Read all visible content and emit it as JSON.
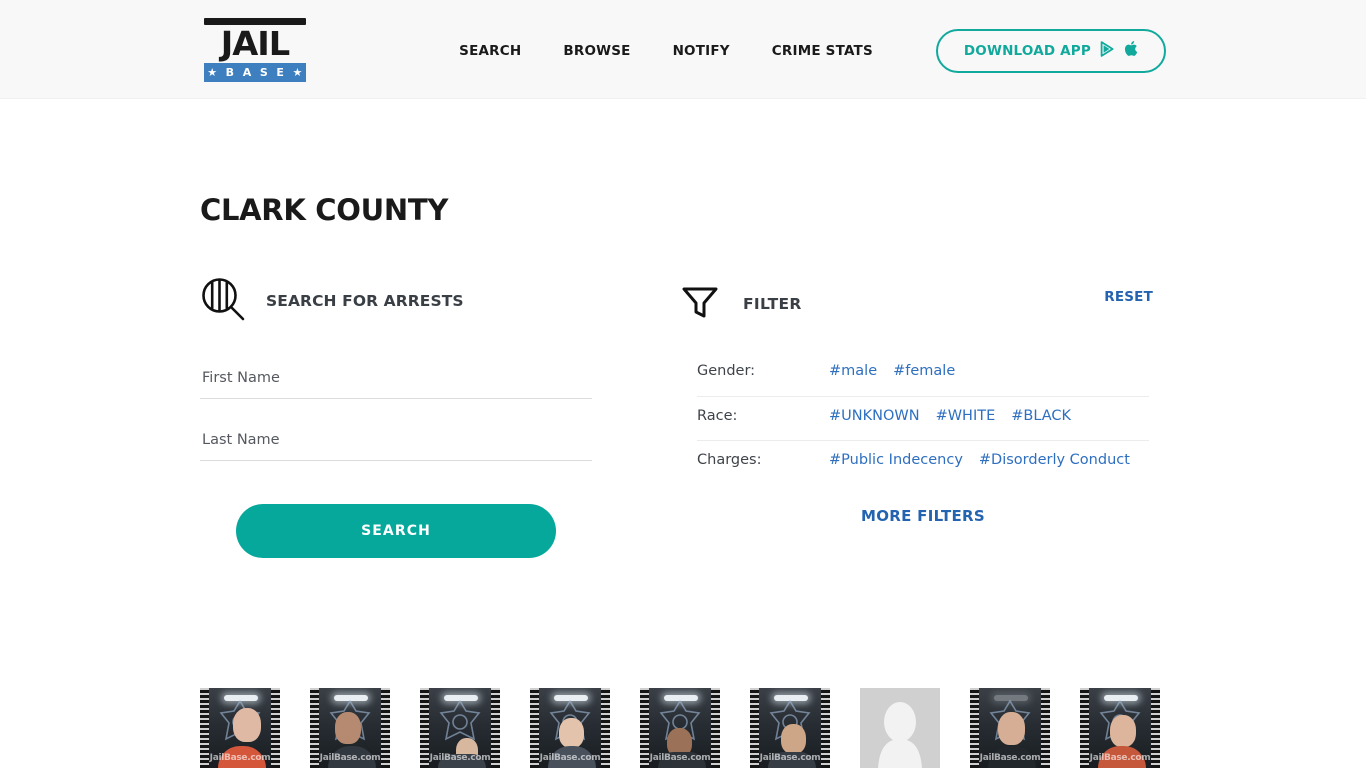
{
  "header": {
    "logo": {
      "name": "JailBase",
      "top_word": "JAIL",
      "bottom_word": "★ B A S E ★"
    },
    "nav": [
      {
        "label": "SEARCH",
        "name": "search"
      },
      {
        "label": "BROWSE",
        "name": "browse"
      },
      {
        "label": "NOTIFY",
        "name": "notify"
      },
      {
        "label": "CRIME STATS",
        "name": "crime-stats"
      }
    ],
    "download": {
      "label": "DOWNLOAD APP",
      "play_icon": "google-play-icon",
      "apple_icon": "apple-icon",
      "accent": "#12a99d"
    }
  },
  "page": {
    "title": "CLARK COUNTY"
  },
  "search": {
    "icon": "magnifier-jailbars-icon",
    "heading": "SEARCH FOR ARRESTS",
    "first_name": {
      "placeholder": "First Name",
      "value": ""
    },
    "last_name": {
      "placeholder": "Last Name",
      "value": ""
    },
    "button_label": "SEARCH",
    "button_color": "#06a89c"
  },
  "filter": {
    "icon": "funnel-icon",
    "heading": "FILTER",
    "reset_label": "RESET",
    "more_label": "MORE FILTERS",
    "link_color": "#2463b0",
    "rows": [
      {
        "label": "Gender:",
        "tags": [
          "#male",
          "#female"
        ]
      },
      {
        "label": "Race:",
        "tags": [
          "#UNKNOWN",
          "#WHITE",
          "#BLACK"
        ]
      },
      {
        "label": "Charges:",
        "tags": [
          "#Public Indecency",
          "#Disorderly Conduct"
        ]
      }
    ]
  },
  "thumbnails": {
    "watermark": "JailBase.com",
    "items": [
      {
        "type": "mugshot",
        "name": "mugshot-1"
      },
      {
        "type": "mugshot",
        "name": "mugshot-2"
      },
      {
        "type": "mugshot",
        "name": "mugshot-3"
      },
      {
        "type": "mugshot",
        "name": "mugshot-4"
      },
      {
        "type": "mugshot",
        "name": "mugshot-5"
      },
      {
        "type": "mugshot",
        "name": "mugshot-6"
      },
      {
        "type": "placeholder",
        "name": "mugshot-placeholder"
      },
      {
        "type": "mugshot",
        "name": "mugshot-8"
      },
      {
        "type": "mugshot",
        "name": "mugshot-9"
      }
    ]
  }
}
